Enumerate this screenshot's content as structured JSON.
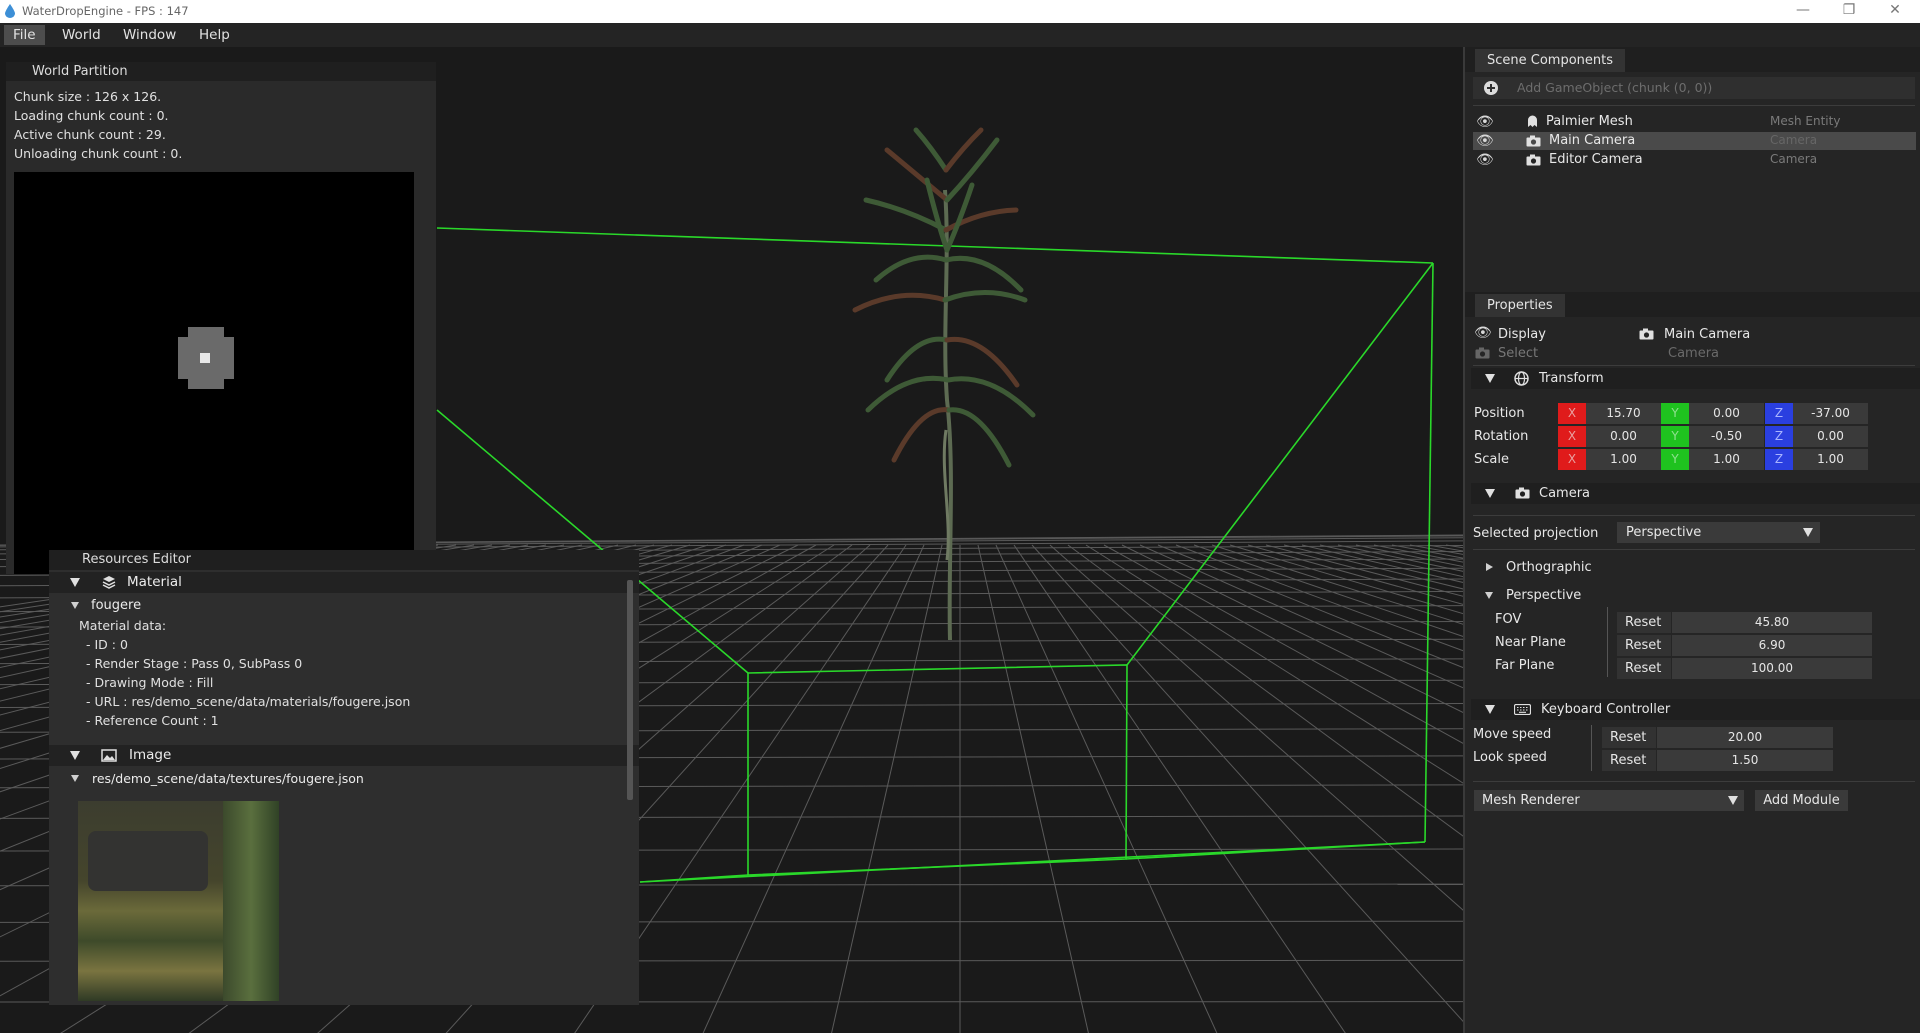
{
  "window": {
    "title": "WaterDropEngine - FPS : 147",
    "minimize": "—",
    "maximize": "❐",
    "close": "✕"
  },
  "menu": [
    "File",
    "World",
    "Window",
    "Help"
  ],
  "world_partition": {
    "title": "World Partition",
    "chunk_size": "Chunk size : 126 x 126.",
    "loading": "Loading chunk count : 0.",
    "active": "Active chunk count : 29.",
    "unloading": "Unloading chunk count : 0."
  },
  "resources_editor": {
    "title": "Resources Editor",
    "material_section": "Material",
    "material_name": "fougere",
    "material_data_label": "Material data:",
    "lines": [
      "- ID : 0",
      "- Render Stage : Pass 0, SubPass 0",
      "- Drawing Mode : Fill",
      "- URL : res/demo_scene/data/materials/fougere.json",
      "- Reference Count : 1"
    ],
    "image_section": "Image",
    "image_path": "res/demo_scene/data/textures/fougere.json"
  },
  "scene_components": {
    "tab": "Scene Components",
    "add_placeholder": "Add GameObject (chunk (0, 0))",
    "items": [
      {
        "name": "Palmier Mesh",
        "type": "Mesh Entity",
        "selected": false
      },
      {
        "name": "Main Camera",
        "type": "Camera",
        "selected": true
      },
      {
        "name": "Editor Camera",
        "type": "Camera",
        "selected": false
      }
    ]
  },
  "properties": {
    "tab": "Properties",
    "display": "Display",
    "select": "Select",
    "object_name": "Main Camera",
    "object_type": "Camera",
    "transform": {
      "title": "Transform",
      "rows": [
        {
          "label": "Position",
          "x": "15.70",
          "y": "0.00",
          "z": "-37.00"
        },
        {
          "label": "Rotation",
          "x": "0.00",
          "y": "-0.50",
          "z": "0.00"
        },
        {
          "label": "Scale",
          "x": "1.00",
          "y": "1.00",
          "z": "1.00"
        }
      ],
      "axis_x": "X",
      "axis_y": "Y",
      "axis_z": "Z"
    },
    "camera": {
      "title": "Camera",
      "projection_label": "Selected projection",
      "projection_value": "Perspective",
      "orthographic": "Orthographic",
      "perspective": "Perspective",
      "reset": "Reset",
      "fields": [
        {
          "label": "FOV",
          "value": "45.80"
        },
        {
          "label": "Near Plane",
          "value": "6.90"
        },
        {
          "label": "Far Plane",
          "value": "100.00"
        }
      ]
    },
    "keyboard": {
      "title": "Keyboard Controller",
      "reset": "Reset",
      "fields": [
        {
          "label": "Move speed",
          "value": "20.00"
        },
        {
          "label": "Look speed",
          "value": "1.50"
        }
      ]
    },
    "module_select": "Mesh Renderer",
    "add_module": "Add Module"
  },
  "colors": {
    "axis_x": "#e01b1b",
    "axis_y": "#1fc21f",
    "axis_z": "#2a3fe0",
    "bounds_green": "#2ad82a",
    "selected_row": "#4a4a4a"
  }
}
